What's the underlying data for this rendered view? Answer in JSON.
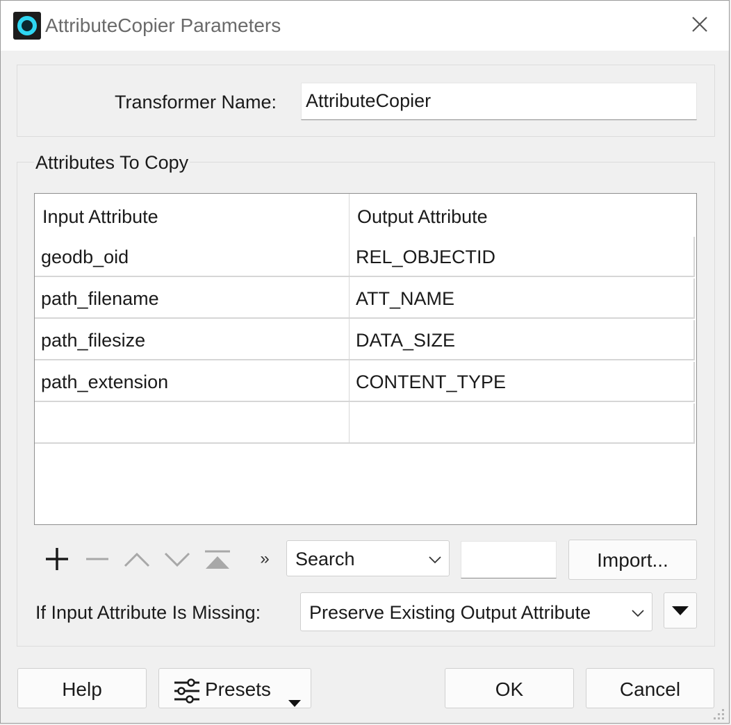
{
  "window": {
    "title": "AttributeCopier Parameters",
    "close_icon": "close-icon"
  },
  "transformer": {
    "label": "Transformer Name:",
    "value": "AttributeCopier"
  },
  "attributes_group": {
    "title": "Attributes To Copy",
    "columns": [
      "Input Attribute",
      "Output Attribute"
    ],
    "rows": [
      {
        "input": "geodb_oid",
        "output": "REL_OBJECTID"
      },
      {
        "input": "path_filename",
        "output": "ATT_NAME"
      },
      {
        "input": "path_filesize",
        "output": "DATA_SIZE"
      },
      {
        "input": "path_extension",
        "output": "CONTENT_TYPE"
      },
      {
        "input": "",
        "output": ""
      }
    ]
  },
  "toolbar": {
    "icons": [
      "plus-icon",
      "minus-icon",
      "chevron-up-icon",
      "chevron-down-icon",
      "move-to-top-icon",
      "more-icon"
    ],
    "more_glyph": "»",
    "search_combo": "Search",
    "search_value": "",
    "import_label": "Import..."
  },
  "missing": {
    "label": "If Input Attribute Is Missing:",
    "value": "Preserve Existing Output Attribute"
  },
  "footer": {
    "help": "Help",
    "presets": "Presets",
    "ok": "OK",
    "cancel": "Cancel"
  }
}
